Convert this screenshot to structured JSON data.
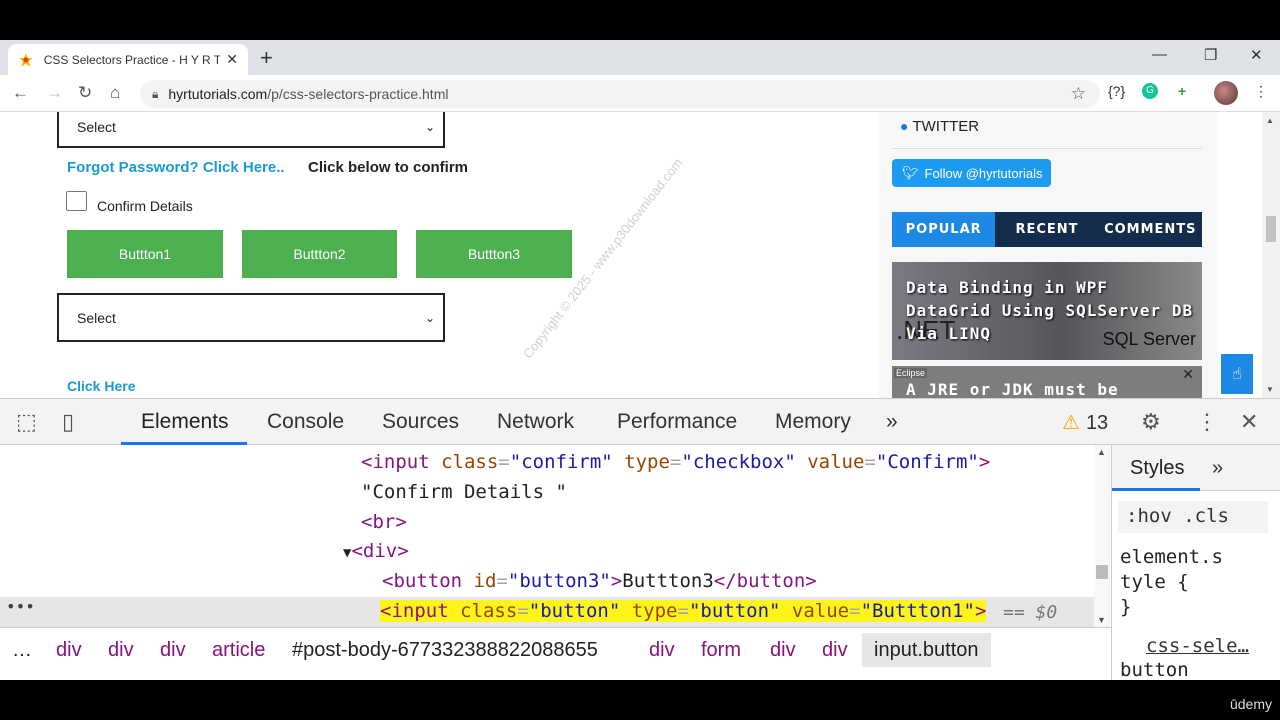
{
  "browser": {
    "tab_title": "CSS Selectors Practice - H Y R Tu",
    "new_tab_symbol": "+",
    "url_domain": "hyrtutorials.com",
    "url_path": "/p/css-selectors-practice.html",
    "ext_icons": [
      "{?}",
      "G",
      "+"
    ]
  },
  "page": {
    "select_top_label": "Select",
    "forgot_password": "Forgot Password? Click Here..",
    "click_below": "Click below to confirm",
    "confirm_details": "Confirm Details",
    "buttons": [
      "Buttton1",
      "Buttton2",
      "Buttton3"
    ],
    "select_bottom_label": "Select",
    "click_here": "Click Here",
    "watermark": "Copyright © 2025 - www.p30download.com"
  },
  "sidebar": {
    "twitter_heading": "TWITTER",
    "follow_button": "Follow @hyrtutorials",
    "tabs": [
      "POPULAR",
      "RECENT",
      "COMMENTS"
    ],
    "post1_caption": "Data Binding in WPF DataGrid Using SQLServer DB Via LINQ",
    "post1_net": ".NET",
    "post1_sql": "SQL Server",
    "post2_badge": "Eclipse",
    "post2_caption": "A JRE or JDK must be"
  },
  "devtools": {
    "tabs": [
      "Elements",
      "Console",
      "Sources",
      "Network",
      "Performance",
      "Memory"
    ],
    "more_tabs": "»",
    "warning_count": "13",
    "code_lines": {
      "l1_tag": "<input",
      "l1_attr1": "class",
      "l1_val1": "\"confirm\"",
      "l1_attr2": "type",
      "l1_val2": "\"checkbox\"",
      "l1_attr3": "value",
      "l1_val3": "\"Confirm\"",
      "l1_end": ">",
      "l2_text": "\"Confirm Details \"",
      "l3_tag": "<br>",
      "l4_tag": "<div>",
      "l5_open": "<button",
      "l5_attr": "id",
      "l5_val": "\"button3\"",
      "l5_text": "Buttton3",
      "l5_close": "</button>",
      "l6_tag": "<input",
      "l6_attr1": "class",
      "l6_val1": "\"button\"",
      "l6_attr2": "type",
      "l6_val2": "\"button\"",
      "l6_attr3": "value",
      "l6_val3": "\"Buttton1\"",
      "l6_end": ">",
      "l6_suffix": "== $0"
    },
    "styles_tab": "Styles",
    "styles_more": "»",
    "hov_cls": ":hov .cls",
    "style_rule_1": "element.s",
    "style_rule_2": "tyle {",
    "style_rule_3": "}",
    "style_source": "css-sele…",
    "style_button": "button",
    "breadcrumbs": [
      "…",
      "div",
      "div",
      "div",
      "article",
      "#post-body-677332388822088655",
      "div",
      "form",
      "div",
      "div",
      "input.button"
    ]
  },
  "footer": {
    "udemy": "ūdemy"
  }
}
